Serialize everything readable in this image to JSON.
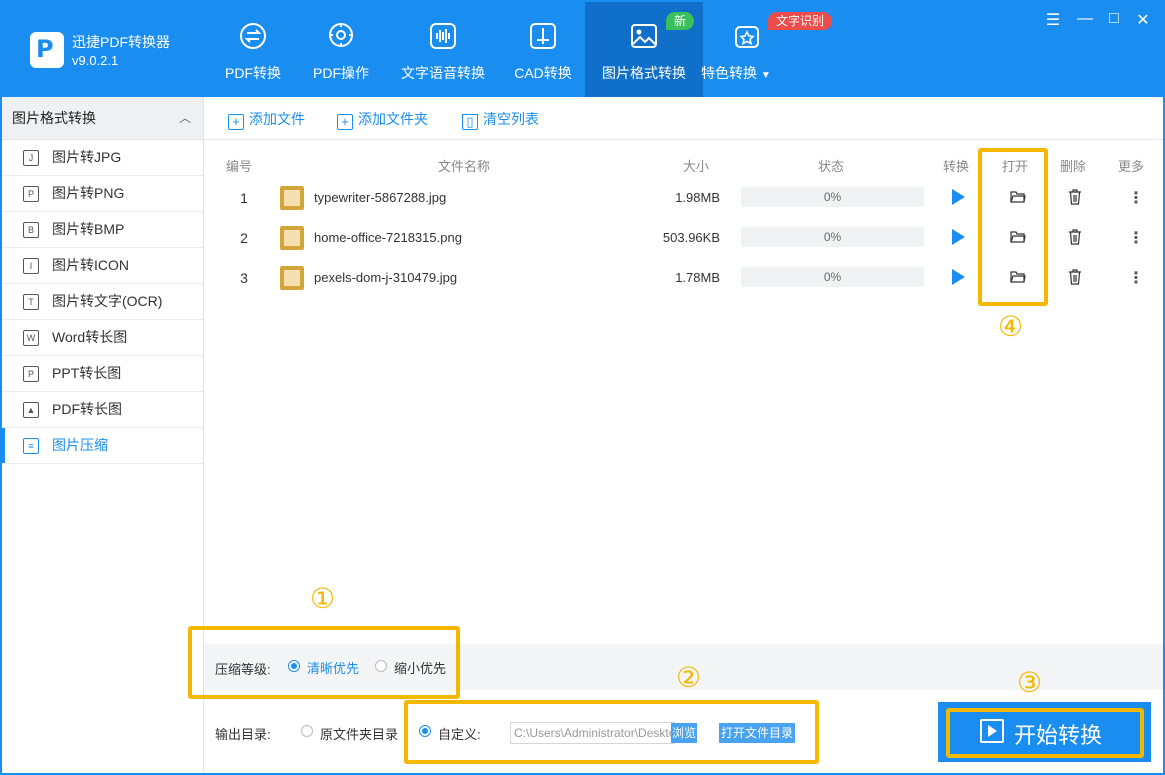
{
  "app": {
    "name": "迅捷PDF转换器",
    "version": "v9.0.2.1",
    "logo_letter": "P"
  },
  "nav": [
    {
      "label": "PDF转换",
      "icon": "pdf-convert-icon"
    },
    {
      "label": "PDF操作",
      "icon": "pdf-operate-icon"
    },
    {
      "label": "文字语音转换",
      "icon": "voice-wave-icon"
    },
    {
      "label": "CAD转换",
      "icon": "cad-icon"
    },
    {
      "label": "图片格式转换",
      "icon": "image-icon",
      "active": true,
      "badge": "新"
    },
    {
      "label": "特色转换",
      "icon": "star-convert-icon",
      "badge": "文字识别",
      "dropdown": "▼"
    }
  ],
  "window": {
    "menu": "☰",
    "minimize": "—",
    "maximize": "□",
    "close": "✕"
  },
  "sidebar": {
    "title": "图片格式转换",
    "collapse": "︿",
    "items": [
      {
        "label": "图片转JPG"
      },
      {
        "label": "图片转PNG"
      },
      {
        "label": "图片转BMP"
      },
      {
        "label": "图片转ICON"
      },
      {
        "label": "图片转文字(OCR)"
      },
      {
        "label": "Word转长图"
      },
      {
        "label": "PPT转长图"
      },
      {
        "label": "PDF转长图"
      },
      {
        "label": "图片压缩",
        "active": true
      }
    ]
  },
  "toolbar": {
    "add_file": "添加文件",
    "add_folder": "添加文件夹",
    "clear_list": "清空列表"
  },
  "table": {
    "headers": {
      "num": "编号",
      "name": "文件名称",
      "size": "大小",
      "status": "状态",
      "convert": "转换",
      "open": "打开",
      "delete": "删除",
      "more": "更多"
    },
    "rows": [
      {
        "num": "1",
        "name": "typewriter-5867288.jpg",
        "size": "1.98MB",
        "progress": "0%"
      },
      {
        "num": "2",
        "name": "home-office-7218315.png",
        "size": "503.96KB",
        "progress": "0%"
      },
      {
        "num": "3",
        "name": "pexels-dom-j-310479.jpg",
        "size": "1.78MB",
        "progress": "0%"
      }
    ]
  },
  "compress": {
    "label": "压缩等级:",
    "opt_clear": "清晰优先",
    "opt_small": "缩小优先",
    "selected": "清晰优先"
  },
  "output": {
    "label": "输出目录:",
    "opt_original": "原文件夹目录",
    "opt_custom": "自定义:",
    "path": "C:\\Users\\Administrator\\Desktop",
    "browse": "浏览",
    "open_dir": "打开文件目录"
  },
  "start_label": "开始转换",
  "annotations": {
    "m1": "①",
    "m2": "②",
    "m3": "③",
    "m4": "④"
  },
  "colors": {
    "primary": "#1a8ef0",
    "active_nav": "#0f6fc9",
    "highlight": "#f5b800",
    "badge_new": "#3bbf5a",
    "badge_ocr": "#ee4b4b"
  }
}
